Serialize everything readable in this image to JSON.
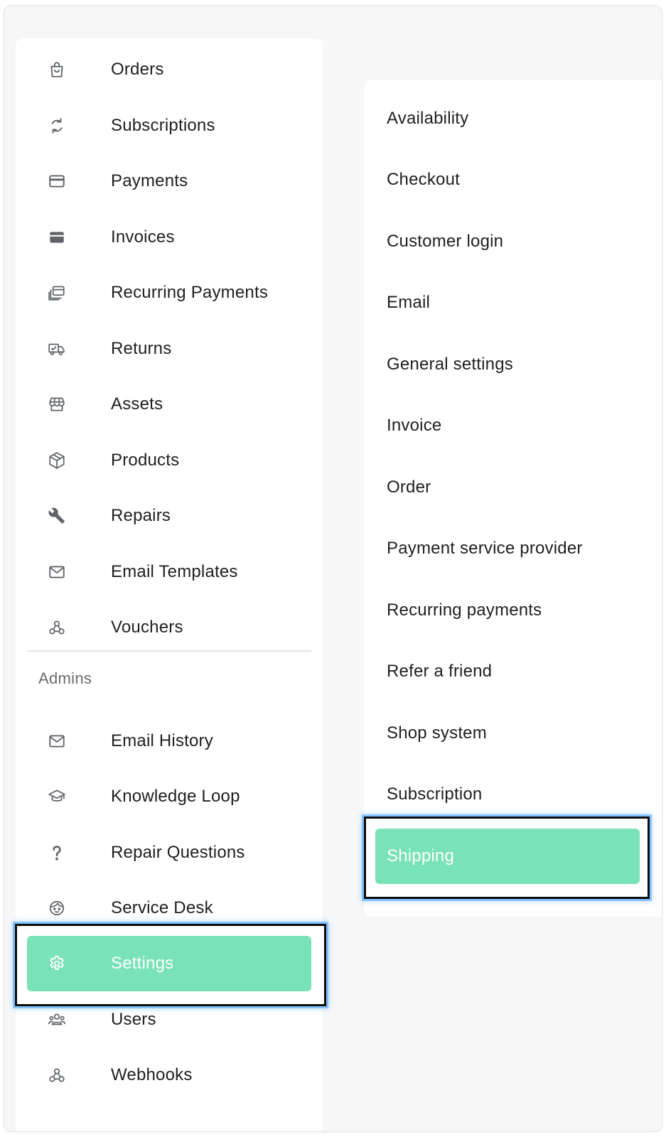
{
  "sidebar": {
    "items": [
      {
        "label": "Orders",
        "icon": "shopping-bag-icon"
      },
      {
        "label": "Subscriptions",
        "icon": "sync-icon"
      },
      {
        "label": "Payments",
        "icon": "credit-card-icon"
      },
      {
        "label": "Invoices",
        "icon": "card-filled-icon"
      },
      {
        "label": "Recurring Payments",
        "icon": "stacked-cards-icon"
      },
      {
        "label": "Returns",
        "icon": "delivery-truck-icon"
      },
      {
        "label": "Assets",
        "icon": "storefront-icon"
      },
      {
        "label": "Products",
        "icon": "package-icon"
      },
      {
        "label": "Repairs",
        "icon": "wrench-icon"
      },
      {
        "label": "Email Templates",
        "icon": "envelope-icon"
      },
      {
        "label": "Vouchers",
        "icon": "webhook-icon"
      }
    ],
    "admins_title": "Admins",
    "admin_items": [
      {
        "label": "Email History",
        "icon": "envelope-icon"
      },
      {
        "label": "Knowledge Loop",
        "icon": "graduation-cap-icon"
      },
      {
        "label": "Repair Questions",
        "icon": "question-mark-icon"
      },
      {
        "label": "Service Desk",
        "icon": "support-agent-icon"
      },
      {
        "label": "Settings",
        "icon": "gear-icon",
        "active": true
      },
      {
        "label": "Users",
        "icon": "users-group-icon"
      },
      {
        "label": "Webhooks",
        "icon": "webhook-icon"
      }
    ]
  },
  "settings_menu": {
    "items": [
      {
        "label": "Availability"
      },
      {
        "label": "Checkout"
      },
      {
        "label": "Customer login"
      },
      {
        "label": "Email"
      },
      {
        "label": "General settings"
      },
      {
        "label": "Invoice"
      },
      {
        "label": "Order"
      },
      {
        "label": "Payment service provider"
      },
      {
        "label": "Recurring payments"
      },
      {
        "label": "Refer a friend"
      },
      {
        "label": "Shop system"
      },
      {
        "label": "Subscription"
      },
      {
        "label": "Shipping",
        "active": true
      }
    ]
  },
  "colors": {
    "accent": "#79e2b7",
    "text": "#1f1f1f",
    "icon": "#5f6368",
    "muted": "#6a6a6a",
    "highlight_border": "#0c0c0c"
  }
}
